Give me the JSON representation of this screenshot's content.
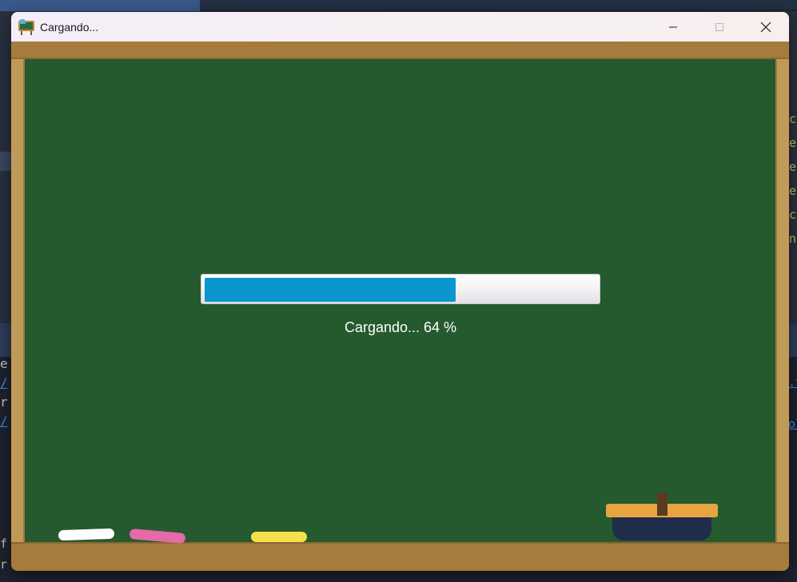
{
  "window": {
    "title": "Cargando...",
    "controls": {
      "minimize_icon": "minimize-icon",
      "maximize_icon": "maximize-icon",
      "close_icon": "close-icon"
    }
  },
  "loader": {
    "progress_percent": 64,
    "label": "Cargando... 64 %",
    "bar_color": "#0a97cf"
  },
  "board": {
    "chalk_colors": [
      "#ffffff",
      "#e46aa8",
      "#f4e04a"
    ],
    "board_color": "#255a2f",
    "frame_color": "#a67c3c"
  },
  "background": {
    "right_code_lines": [
      "pc",
      "ce",
      "ce",
      "ge",
      "ic",
      "In"
    ],
    "left_code_lines": [
      "e",
      "/",
      "r",
      "/"
    ],
    "right_link_lines": [
      ".t",
      "",
      "ol"
    ],
    "bottom_code_lines": [
      "f",
      "r"
    ]
  }
}
